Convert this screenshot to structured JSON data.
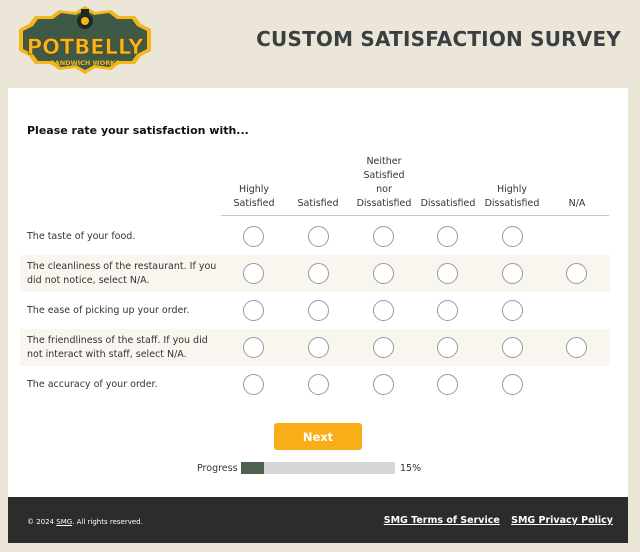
{
  "brand": {
    "logo_text": "POTBELLY",
    "logo_subtext": "SANDWICH WORKS",
    "colors": {
      "logo_bg": "#3e5a46",
      "logo_text": "#f5b51b",
      "accent": "#f9ae17",
      "progress": "#4f6150",
      "footer": "#2c2c2c"
    }
  },
  "header": {
    "title": "CUSTOM SATISFACTION SURVEY"
  },
  "question": {
    "prompt": "Please rate your satisfaction with..."
  },
  "columns": [
    {
      "lines": [
        "Highly",
        "Satisfied"
      ]
    },
    {
      "lines": [
        "Satisfied"
      ]
    },
    {
      "lines": [
        "Neither",
        "Satisfied",
        "nor",
        "Dissatisfied"
      ]
    },
    {
      "lines": [
        "Dissatisfied"
      ]
    },
    {
      "lines": [
        "Highly",
        "Dissatisfied"
      ]
    },
    {
      "lines": [
        "N/A"
      ]
    }
  ],
  "rows": [
    {
      "label": "The taste of your food.",
      "has_na": false,
      "selected": null
    },
    {
      "label": "The cleanliness of the restaurant. If you did not notice, select N/A.",
      "has_na": true,
      "selected": null
    },
    {
      "label": "The ease of picking up your order.",
      "has_na": false,
      "selected": null
    },
    {
      "label": "The friendliness of the staff. If you did not interact with staff, select N/A.",
      "has_na": true,
      "selected": null
    },
    {
      "label": "The accuracy of your order.",
      "has_na": false,
      "selected": null
    }
  ],
  "actions": {
    "next_label": "Next"
  },
  "progress": {
    "label": "Progress",
    "percent_text": "15%",
    "value": 0.15
  },
  "footer": {
    "copyright_prefix": "© 2024 ",
    "copyright_link": "SMG",
    "copyright_suffix": ". All rights reserved.",
    "terms_label": "SMG Terms of Service",
    "privacy_label": "SMG Privacy Policy"
  }
}
